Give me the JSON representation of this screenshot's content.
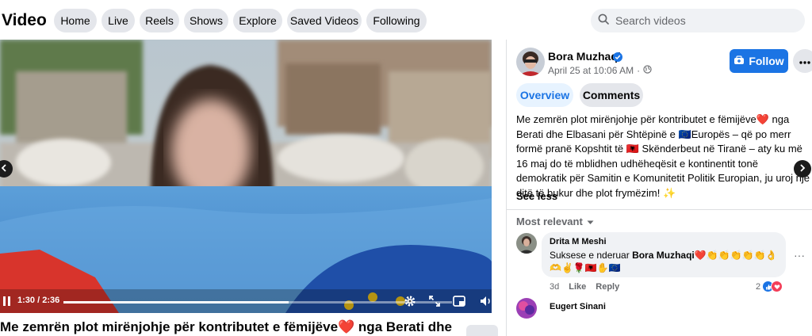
{
  "header": {
    "title": "Video",
    "nav": [
      "Home",
      "Live",
      "Reels",
      "Shows",
      "Explore",
      "Saved Videos",
      "Following"
    ],
    "search_placeholder": "Search videos"
  },
  "player": {
    "current_time": "1:30",
    "duration": "2:36",
    "progress": 0.58
  },
  "video_title": "Me zemrën plot mirënjohje për kontributet e fëmijëve❤️  nga Berati dhe",
  "post": {
    "author": "Bora Muzhaqi",
    "date": "April 25 at 10:06 AM",
    "follow_label": "Follow",
    "tabs": [
      "Overview",
      "Comments"
    ],
    "caption": "Me zemrën plot mirënjohje për kontributet e fëmijëve❤️  nga Berati dhe Elbasani për Shtëpinë e 🇪🇺Europës – që po merr formë pranë Kopshtit të 🇦🇱 Skënderbeut në Tiranë – aty ku më 16 maj do të mblidhen udhëheqësit e kontinentit tonë demokratik për Samitin e Komunitetit Politik Europian, ju uroj një ditë të bukur dhe plot frymëzim! ✨",
    "see_less": "See less"
  },
  "comments": {
    "sort_label": "Most relevant",
    "items": [
      {
        "name": "Drita M Meshi",
        "text_before": "Suksese e nderuar ",
        "mention": "Bora Muzhaqi",
        "text_after": "❤️👏👏👏👏👏👌🫶✌️🌹🇦🇱✋🇪🇺",
        "age": "3d",
        "like": "Like",
        "reply": "Reply",
        "reaction_count": "2"
      },
      {
        "name": "Eugert Sinani"
      }
    ]
  },
  "colors": {
    "accent": "#1b74e4",
    "pill_bg": "#e4e6eb",
    "search_bg": "#f0f2f5"
  }
}
